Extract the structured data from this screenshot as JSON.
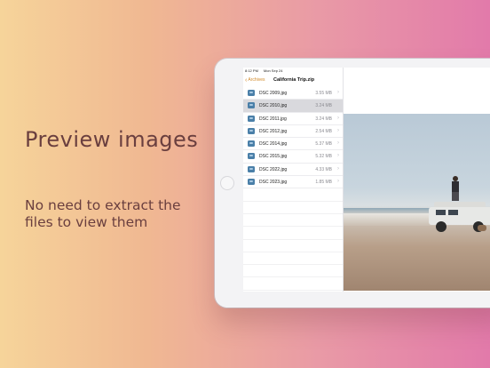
{
  "marketing": {
    "headline": "Preview images",
    "subline": "No need to extract the files to view them"
  },
  "status_bar": {
    "time": "8:12 PM",
    "date": "Mon Sep 24"
  },
  "navigation": {
    "back_label": "Archives",
    "title": "California Trip.zip"
  },
  "files": [
    {
      "name": "DSC 2009.jpg",
      "size": "3.55 MB"
    },
    {
      "name": "DSC 2010.jpg",
      "size": "3.24 MB",
      "selected": true
    },
    {
      "name": "DSC 2011.jpg",
      "size": "3.24 MB"
    },
    {
      "name": "DSC 2012.jpg",
      "size": "2.54 MB"
    },
    {
      "name": "DSC 2014.jpg",
      "size": "5.37 MB"
    },
    {
      "name": "DSC 2015.jpg",
      "size": "5.32 MB"
    },
    {
      "name": "DSC 2022.jpg",
      "size": "4.33 MB"
    },
    {
      "name": "DSC 2023.jpg",
      "size": "1.85 MB"
    }
  ],
  "colors": {
    "accent": "#d18a2a",
    "file_icon": "#4a7fa8",
    "headline_text": "#6a3f3f"
  }
}
